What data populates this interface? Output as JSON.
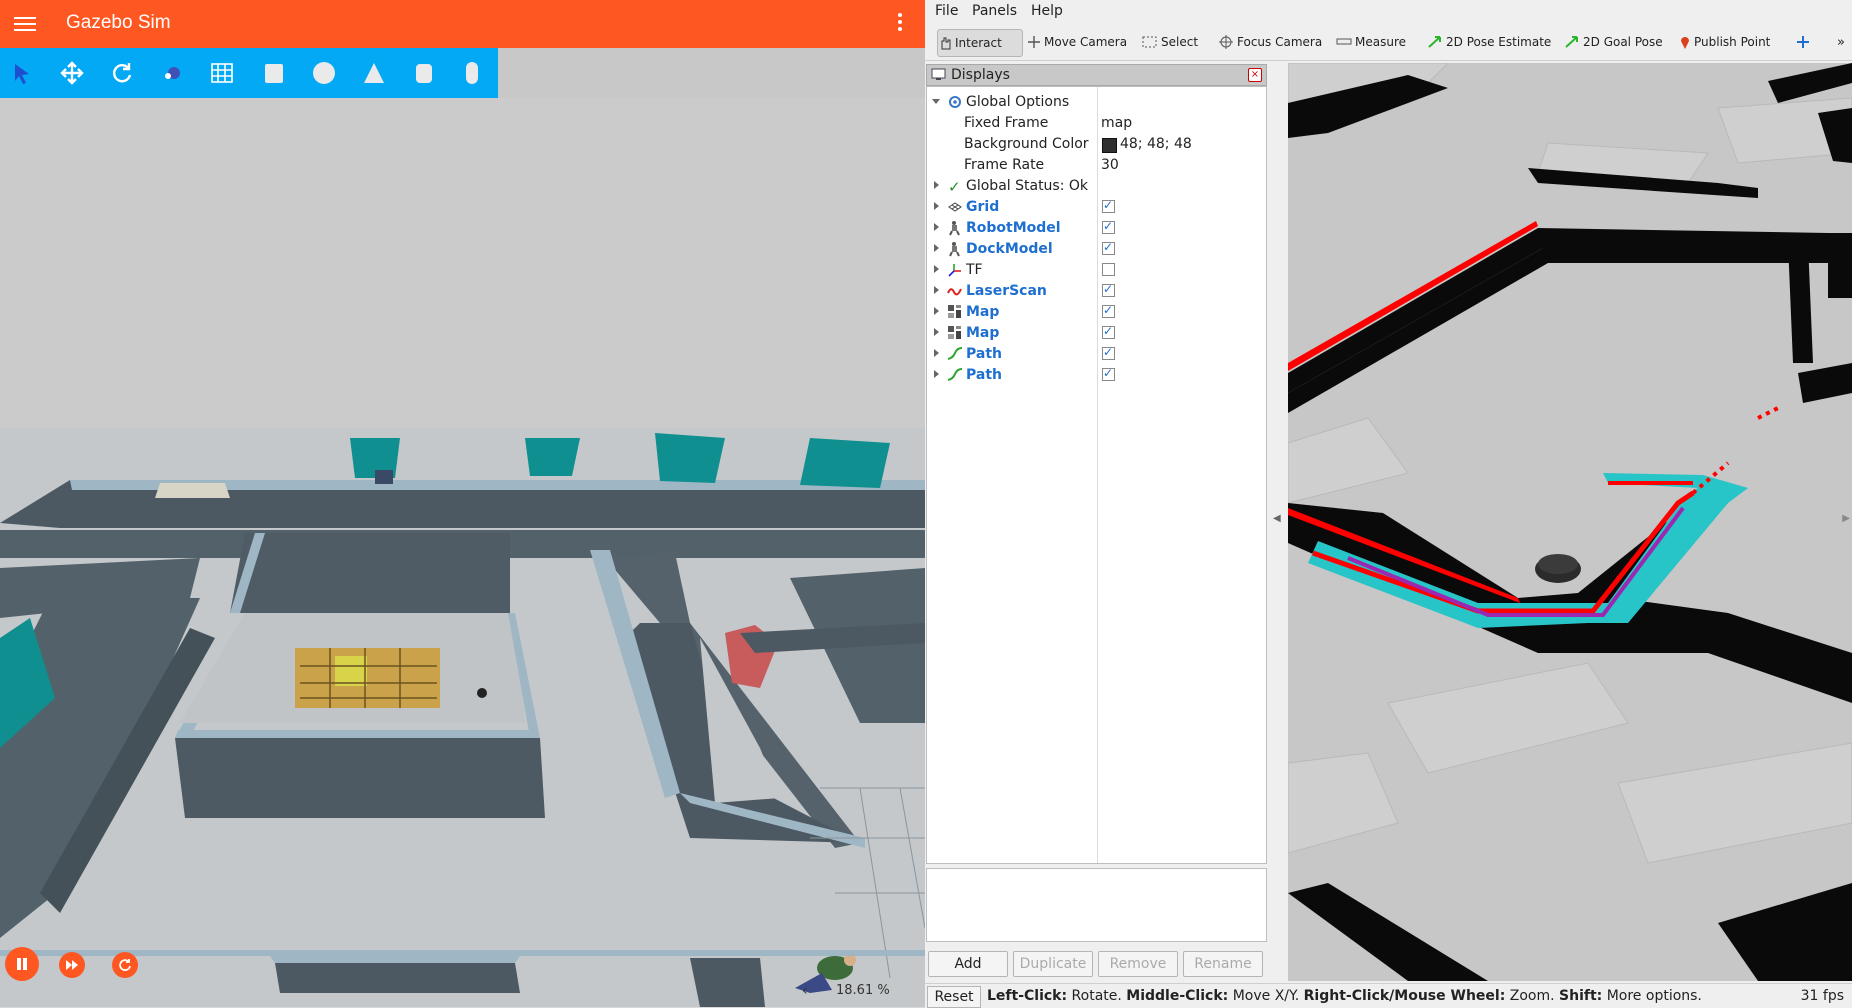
{
  "gazebo": {
    "title": "Gazebo Sim",
    "zoom": "18.61 %",
    "toolbar": [
      "select",
      "translate",
      "rotate",
      "transform-control",
      "grid",
      "box",
      "sphere",
      "cone",
      "cylinder",
      "capsule"
    ],
    "colors": {
      "appbar": "#ff5722",
      "toolbar": "#03a9f4"
    }
  },
  "rviz": {
    "menu": {
      "file": "File",
      "panels": "Panels",
      "help": "Help"
    },
    "toolbar": {
      "interact": "Interact",
      "move_camera": "Move Camera",
      "select": "Select",
      "focus_camera": "Focus Camera",
      "measure": "Measure",
      "pose_estimate": "2D Pose Estimate",
      "goal_pose": "2D Goal Pose",
      "publish_point": "Publish Point"
    },
    "displays": {
      "title": "Displays",
      "global_options": {
        "label": "Global Options",
        "fixed_frame_label": "Fixed Frame",
        "fixed_frame_value": "map",
        "bg_color_label": "Background Color",
        "bg_color_value": "48; 48; 48",
        "frame_rate_label": "Frame Rate",
        "frame_rate_value": "30"
      },
      "global_status": "Global Status: Ok",
      "items": [
        {
          "label": "Grid",
          "checked": true
        },
        {
          "label": "RobotModel",
          "checked": true
        },
        {
          "label": "DockModel",
          "checked": true
        },
        {
          "label": "TF",
          "checked": false
        },
        {
          "label": "LaserScan",
          "checked": true
        },
        {
          "label": "Map",
          "checked": true
        },
        {
          "label": "Map",
          "checked": true
        },
        {
          "label": "Path",
          "checked": true
        },
        {
          "label": "Path",
          "checked": true
        }
      ],
      "buttons": {
        "add": "Add",
        "duplicate": "Duplicate",
        "remove": "Remove",
        "rename": "Rename"
      }
    },
    "status": {
      "reset": "Reset",
      "h1": "Left-Click:",
      "t1": " Rotate. ",
      "h2": "Middle-Click:",
      "t2": " Move X/Y. ",
      "h3": "Right-Click/Mouse Wheel:",
      "t3": " Zoom. ",
      "h4": "Shift:",
      "t4": " More options.",
      "fps": "31 fps"
    },
    "colors": {
      "laser": "#ff0000",
      "costmap": "#27c4c8",
      "path": "#9c27b0",
      "walls": "#000000",
      "free": "#c7c7c7"
    }
  }
}
